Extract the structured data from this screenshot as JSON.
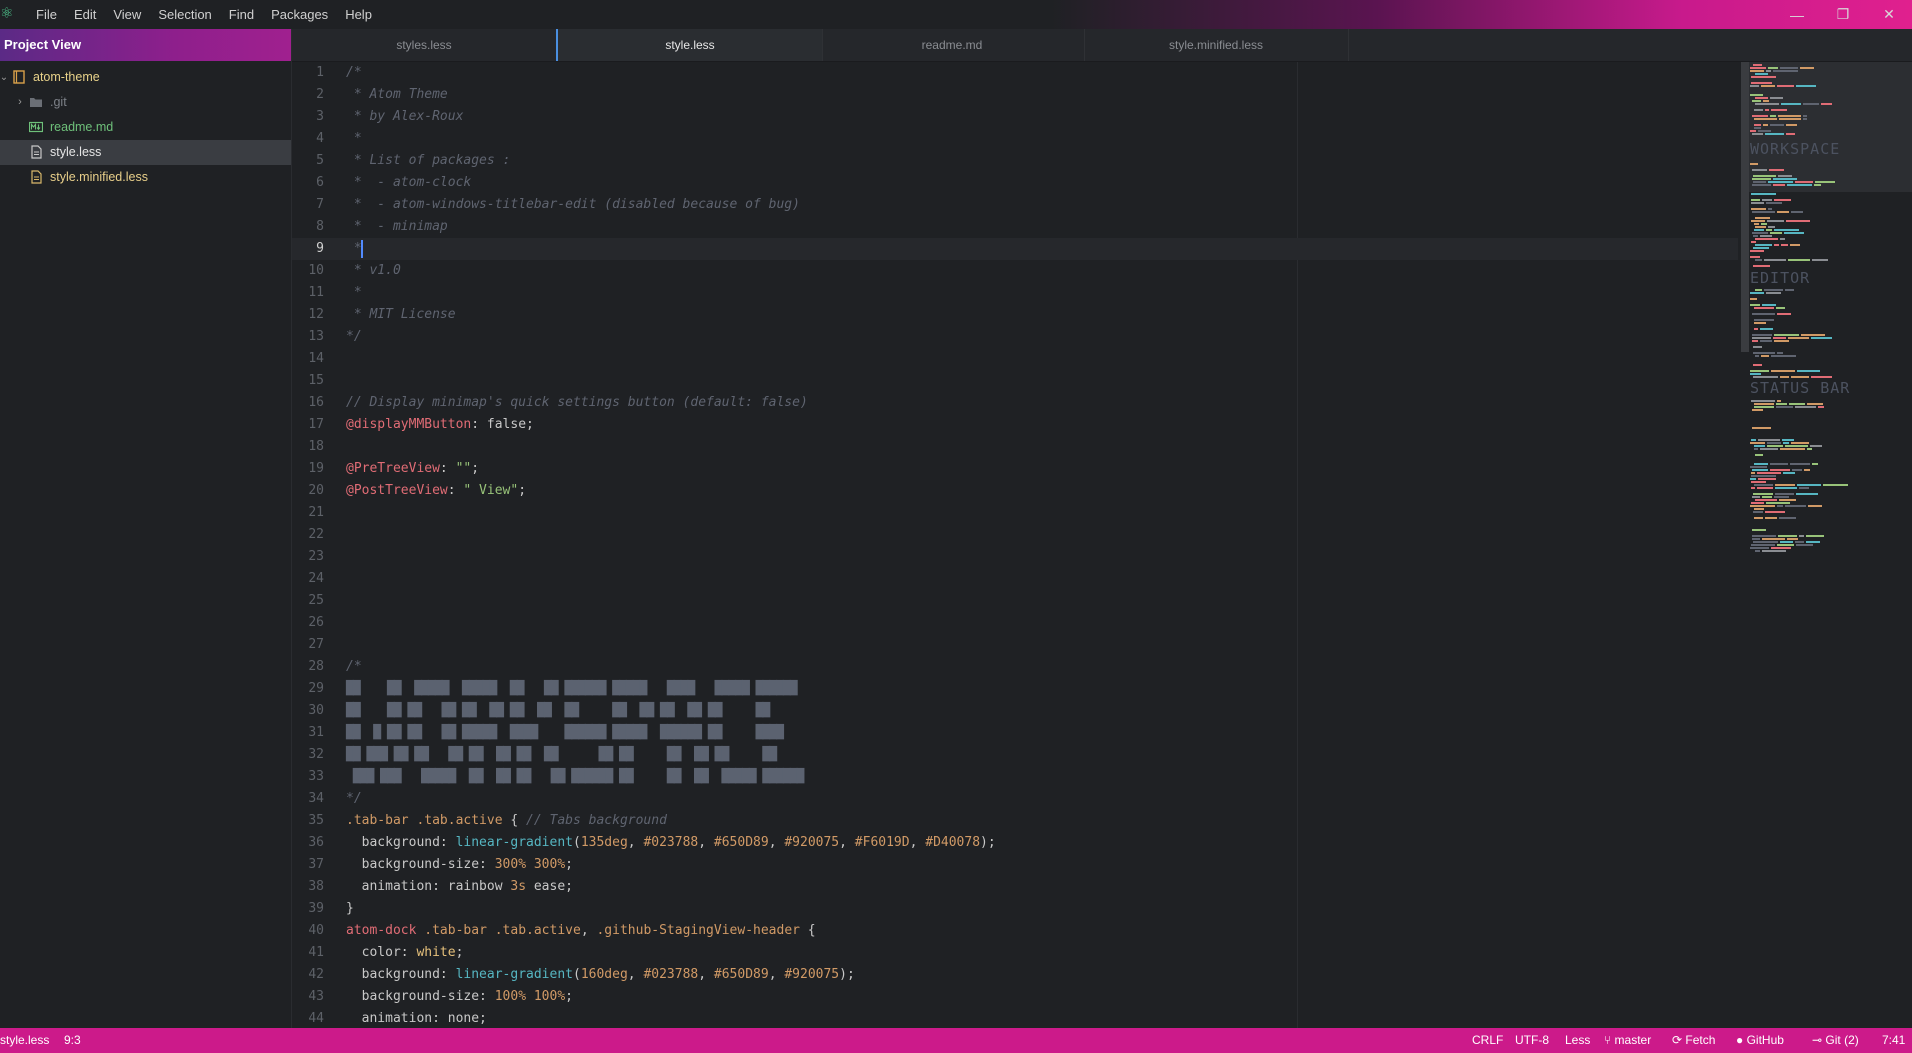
{
  "menu": [
    "File",
    "Edit",
    "View",
    "Selection",
    "Find",
    "Packages",
    "Help"
  ],
  "window_controls": {
    "minimize": "—",
    "maximize": "❐",
    "close": "✕"
  },
  "sidebar": {
    "title": "Project View",
    "root": "atom-theme",
    "items": [
      {
        "name": ".git",
        "type": "folder"
      },
      {
        "name": "readme.md",
        "type": "markdown"
      },
      {
        "name": "style.less",
        "type": "file",
        "selected": true
      },
      {
        "name": "style.minified.less",
        "type": "file"
      }
    ]
  },
  "tabs": [
    {
      "label": "styles.less"
    },
    {
      "label": "style.less",
      "active": true
    },
    {
      "label": "readme.md"
    },
    {
      "label": "style.minified.less"
    }
  ],
  "editor": {
    "cursor_line": 9,
    "lines": [
      {
        "n": "1",
        "parts": [
          {
            "t": "/*",
            "c": "comment"
          }
        ]
      },
      {
        "n": "2",
        "parts": [
          {
            "t": " * Atom Theme",
            "c": "comment"
          }
        ]
      },
      {
        "n": "3",
        "parts": [
          {
            "t": " * by Alex-Roux",
            "c": "comment"
          }
        ]
      },
      {
        "n": "4",
        "parts": [
          {
            "t": " *",
            "c": "comment"
          }
        ]
      },
      {
        "n": "5",
        "parts": [
          {
            "t": " * List of packages :",
            "c": "comment"
          }
        ]
      },
      {
        "n": "6",
        "parts": [
          {
            "t": " *  - atom-clock",
            "c": "comment"
          }
        ]
      },
      {
        "n": "7",
        "parts": [
          {
            "t": " *  - atom-windows-titlebar-edit (disabled because of bug)",
            "c": "comment"
          }
        ]
      },
      {
        "n": "8",
        "parts": [
          {
            "t": " *  - minimap",
            "c": "comment"
          }
        ]
      },
      {
        "n": "9",
        "parts": [
          {
            "t": " *",
            "c": "comment"
          }
        ]
      },
      {
        "n": "10",
        "parts": [
          {
            "t": " * v1.0",
            "c": "comment"
          }
        ]
      },
      {
        "n": "11",
        "parts": [
          {
            "t": " *",
            "c": "comment"
          }
        ]
      },
      {
        "n": "12",
        "parts": [
          {
            "t": " * MIT License",
            "c": "comment"
          }
        ]
      },
      {
        "n": "13",
        "parts": [
          {
            "t": "*/",
            "c": "comment"
          }
        ]
      },
      {
        "n": "14",
        "parts": []
      },
      {
        "n": "15",
        "parts": []
      },
      {
        "n": "16",
        "parts": [
          {
            "t": "// Display minimap's quick settings button (default: false)",
            "c": "comment"
          }
        ]
      },
      {
        "n": "17",
        "parts": [
          {
            "t": "@displayMMButton",
            "c": "var"
          },
          {
            "t": ": false;",
            "c": "prop"
          }
        ]
      },
      {
        "n": "18",
        "parts": []
      },
      {
        "n": "19",
        "parts": [
          {
            "t": "@PreTreeView",
            "c": "var"
          },
          {
            "t": ": ",
            "c": "prop"
          },
          {
            "t": "\"\"",
            "c": "str"
          },
          {
            "t": ";",
            "c": "prop"
          }
        ]
      },
      {
        "n": "20",
        "parts": [
          {
            "t": "@PostTreeView",
            "c": "var"
          },
          {
            "t": ": ",
            "c": "prop"
          },
          {
            "t": "\" View\"",
            "c": "str"
          },
          {
            "t": ";",
            "c": "prop"
          }
        ]
      },
      {
        "n": "21",
        "parts": []
      },
      {
        "n": "22",
        "parts": []
      },
      {
        "n": "23",
        "parts": []
      },
      {
        "n": "24",
        "parts": []
      },
      {
        "n": "25",
        "parts": []
      },
      {
        "n": "26",
        "parts": []
      },
      {
        "n": "27",
        "parts": []
      },
      {
        "n": "28",
        "parts": [
          {
            "t": "/*",
            "c": "comment"
          }
        ]
      },
      {
        "n": "29",
        "parts": [
          {
            "t": "██    ██  █████  █████  ██   ██ ██████ █████   ████   █████ ██████",
            "c": "art"
          }
        ]
      },
      {
        "n": "30",
        "parts": [
          {
            "t": "██    ██ ██   ██ ██  ██ ██  ██  ██     ██  ██ ██  ██ ██     ██",
            "c": "art"
          }
        ]
      },
      {
        "n": "31",
        "parts": [
          {
            "t": "██  █ ██ ██   ██ █████  ████    ██████ █████  ██████ ██     ████",
            "c": "art"
          }
        ]
      },
      {
        "n": "32",
        "parts": [
          {
            "t": "██ ███ ██ ██   ██ ██  ██ ██  ██      ██ ██     ██  ██ ██     ██",
            "c": "art"
          }
        ]
      },
      {
        "n": "33",
        "parts": [
          {
            "t": " ███ ███   █████  ██  ██ ██   ██ ██████ ██     ██  ██  █████ ██████",
            "c": "art"
          }
        ]
      },
      {
        "n": "34",
        "parts": [
          {
            "t": "*/",
            "c": "comment"
          }
        ]
      },
      {
        "n": "35",
        "parts": [
          {
            "t": ".tab-bar .tab.active",
            "c": "sel"
          },
          {
            "t": " { ",
            "c": "prop"
          },
          {
            "t": "// Tabs background",
            "c": "comment"
          }
        ]
      },
      {
        "n": "36",
        "parts": [
          {
            "t": "  background: ",
            "c": "prop"
          },
          {
            "t": "linear-gradient",
            "c": "fn"
          },
          {
            "t": "(",
            "c": "prop"
          },
          {
            "t": "135deg",
            "c": "num"
          },
          {
            "t": ", ",
            "c": "prop"
          },
          {
            "t": "#023788",
            "c": "num"
          },
          {
            "t": ", ",
            "c": "prop"
          },
          {
            "t": "#650D89",
            "c": "num"
          },
          {
            "t": ", ",
            "c": "prop"
          },
          {
            "t": "#920075",
            "c": "num"
          },
          {
            "t": ", ",
            "c": "prop"
          },
          {
            "t": "#F6019D",
            "c": "num"
          },
          {
            "t": ", ",
            "c": "prop"
          },
          {
            "t": "#D40078",
            "c": "num"
          },
          {
            "t": ");",
            "c": "prop"
          }
        ]
      },
      {
        "n": "37",
        "parts": [
          {
            "t": "  background-size: ",
            "c": "prop"
          },
          {
            "t": "300% 300%",
            "c": "num"
          },
          {
            "t": ";",
            "c": "prop"
          }
        ]
      },
      {
        "n": "38",
        "parts": [
          {
            "t": "  animation: ",
            "c": "prop"
          },
          {
            "t": "rainbow ",
            "c": "prop"
          },
          {
            "t": "3s",
            "c": "num"
          },
          {
            "t": " ease;",
            "c": "prop"
          }
        ]
      },
      {
        "n": "39",
        "parts": [
          {
            "t": "}",
            "c": "prop"
          }
        ]
      },
      {
        "n": "40",
        "parts": [
          {
            "t": "atom-dock",
            "c": "var"
          },
          {
            "t": " .tab-bar .tab.active",
            "c": "sel"
          },
          {
            "t": ", ",
            "c": "prop"
          },
          {
            "t": ".github-StagingView-header",
            "c": "sel"
          },
          {
            "t": " {",
            "c": "prop"
          }
        ]
      },
      {
        "n": "41",
        "parts": [
          {
            "t": "  color: ",
            "c": "prop"
          },
          {
            "t": "white",
            "c": "key"
          },
          {
            "t": ";",
            "c": "prop"
          }
        ]
      },
      {
        "n": "42",
        "parts": [
          {
            "t": "  background: ",
            "c": "prop"
          },
          {
            "t": "linear-gradient",
            "c": "fn"
          },
          {
            "t": "(",
            "c": "prop"
          },
          {
            "t": "160deg",
            "c": "num"
          },
          {
            "t": ", ",
            "c": "prop"
          },
          {
            "t": "#023788",
            "c": "num"
          },
          {
            "t": ", ",
            "c": "prop"
          },
          {
            "t": "#650D89",
            "c": "num"
          },
          {
            "t": ", ",
            "c": "prop"
          },
          {
            "t": "#920075",
            "c": "num"
          },
          {
            "t": ");",
            "c": "prop"
          }
        ]
      },
      {
        "n": "43",
        "parts": [
          {
            "t": "  background-size: ",
            "c": "prop"
          },
          {
            "t": "100% 100%",
            "c": "num"
          },
          {
            "t": ";",
            "c": "prop"
          }
        ]
      },
      {
        "n": "44",
        "parts": [
          {
            "t": "  animation: none;",
            "c": "prop"
          }
        ]
      }
    ]
  },
  "minimap": {
    "headings": [
      "WORKSPACE",
      "EDITOR",
      "STATUS BAR"
    ]
  },
  "statusbar": {
    "file": "style.less",
    "cursor": "9:3",
    "line_ending": "CRLF",
    "encoding": "UTF-8",
    "grammar": "Less",
    "branch": "master",
    "fetch": "Fetch",
    "github": "GitHub",
    "git": "Git (2)",
    "clock": "7:41"
  },
  "colors": {
    "accent": "#cc1a8a",
    "sidebar_header": "#8e1f8c",
    "cursor": "#528bff"
  }
}
